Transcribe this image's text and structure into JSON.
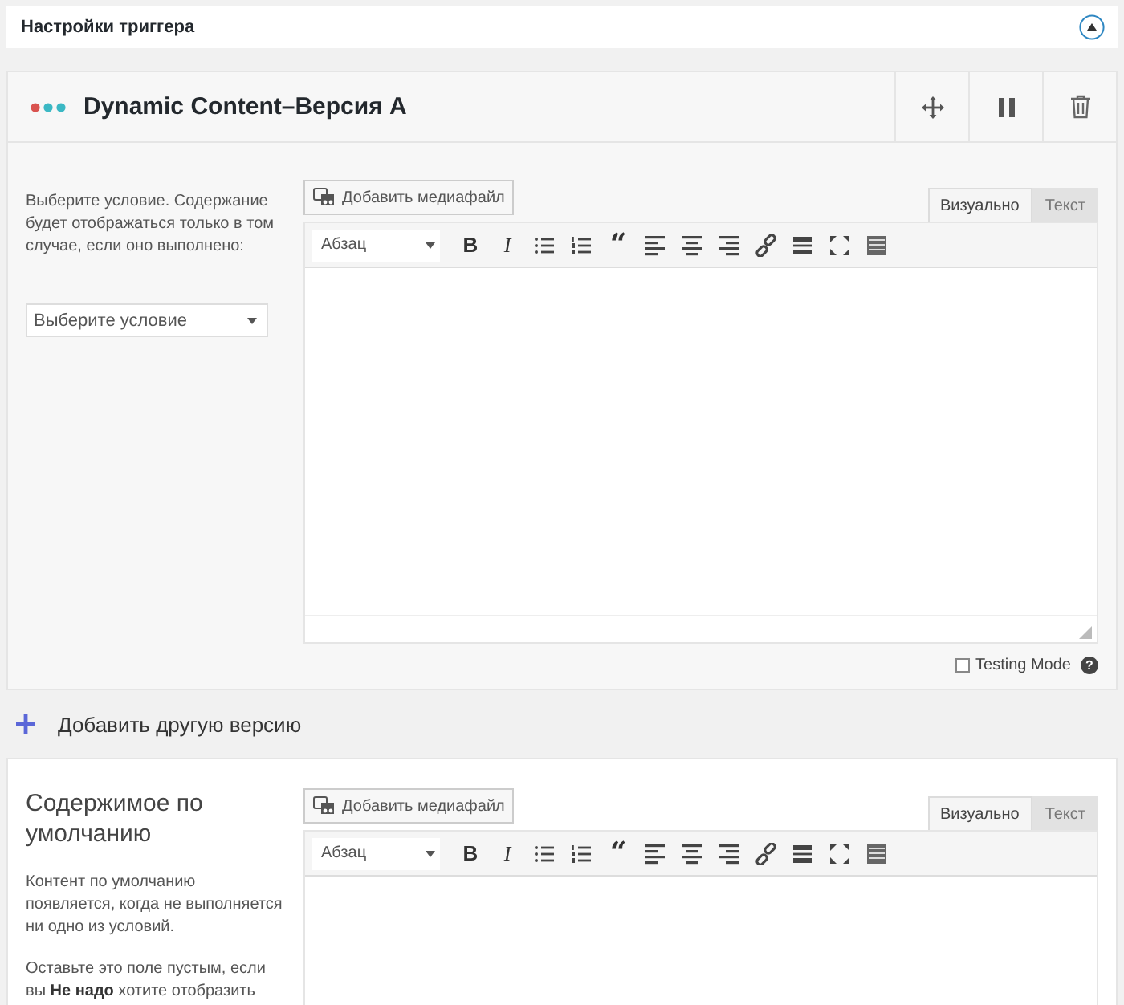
{
  "trigger_settings": {
    "title": "Настройки триггера",
    "expanded": true
  },
  "version": {
    "title": "Dynamic Content–Версия A",
    "dots": [
      {
        "color": "#d9534f"
      },
      {
        "color": "#3bb8c4"
      },
      {
        "color": "#3bb8c4"
      }
    ],
    "description": "Выберите условие. Содержание будет отображаться только в том случае, если оно выполнено:",
    "condition_select": {
      "value": "Выберите условие"
    },
    "editor": {
      "media_button": "Добавить медиафайл",
      "tabs": [
        {
          "label": "Визуально",
          "selected": true
        },
        {
          "label": "Текст",
          "selected": false
        }
      ],
      "format_select": "Абзац",
      "toolbar": [
        {
          "kind": "bold",
          "label": "B"
        },
        {
          "kind": "italic",
          "label": "I"
        },
        {
          "kind": "bullet-list"
        },
        {
          "kind": "numbered-list"
        },
        {
          "kind": "quote",
          "label": "“"
        },
        {
          "kind": "align-left"
        },
        {
          "kind": "align-center"
        },
        {
          "kind": "align-right"
        },
        {
          "kind": "link"
        },
        {
          "kind": "more"
        },
        {
          "kind": "fullscreen"
        },
        {
          "kind": "toolbar-toggle"
        }
      ]
    },
    "testing_mode": {
      "label": "Testing Mode",
      "checked": false,
      "help": "?"
    }
  },
  "add_version": {
    "label": "Добавить другую версию"
  },
  "default_content": {
    "title": "Содержимое по умолчанию",
    "paragraphs": [
      "Контент по умолчанию появляется, когда не выполняется ни одно из условий.",
      "Оставьте это поле пустым, если вы **Не надо** хотите отобразить"
    ],
    "editor": {
      "media_button": "Добавить медиафайл",
      "tabs": [
        {
          "label": "Визуально",
          "selected": true
        },
        {
          "label": "Текст",
          "selected": false
        }
      ],
      "format_select": "Абзац",
      "toolbar": [
        {
          "kind": "bold",
          "label": "B"
        },
        {
          "kind": "italic",
          "label": "I"
        },
        {
          "kind": "bullet-list"
        },
        {
          "kind": "numbered-list"
        },
        {
          "kind": "quote",
          "label": "“"
        },
        {
          "kind": "align-left"
        },
        {
          "kind": "align-center"
        },
        {
          "kind": "align-right"
        },
        {
          "kind": "link"
        },
        {
          "kind": "more"
        },
        {
          "kind": "fullscreen"
        },
        {
          "kind": "toolbar-toggle"
        }
      ]
    }
  }
}
